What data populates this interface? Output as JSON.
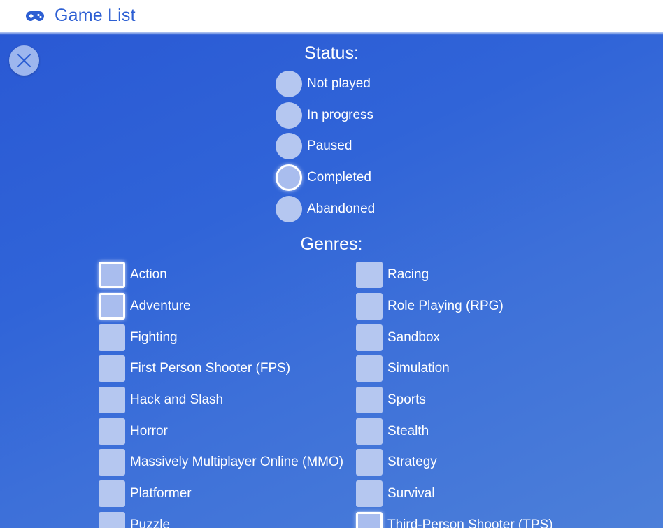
{
  "header": {
    "title": "Game List",
    "icon": "gamepad-icon",
    "title_color": "#2d5fd3"
  },
  "close_icon": "close-icon",
  "status": {
    "title": "Status:",
    "options": [
      {
        "label": "Not played",
        "selected": false
      },
      {
        "label": "In progress",
        "selected": false
      },
      {
        "label": "Paused",
        "selected": false
      },
      {
        "label": "Completed",
        "selected": true
      },
      {
        "label": "Abandoned",
        "selected": false
      }
    ]
  },
  "genres": {
    "title": "Genres:",
    "left": [
      {
        "label": "Action",
        "checked": true
      },
      {
        "label": "Adventure",
        "checked": true
      },
      {
        "label": "Fighting",
        "checked": false
      },
      {
        "label": "First Person Shooter (FPS)",
        "checked": false
      },
      {
        "label": "Hack and Slash",
        "checked": false
      },
      {
        "label": "Horror",
        "checked": false
      },
      {
        "label": "Massively Multiplayer Online (MMO)",
        "checked": false
      },
      {
        "label": "Platformer",
        "checked": false
      },
      {
        "label": "Puzzle",
        "checked": false
      }
    ],
    "right": [
      {
        "label": "Racing",
        "checked": false
      },
      {
        "label": "Role Playing (RPG)",
        "checked": false
      },
      {
        "label": "Sandbox",
        "checked": false
      },
      {
        "label": "Simulation",
        "checked": false
      },
      {
        "label": "Sports",
        "checked": false
      },
      {
        "label": "Stealth",
        "checked": false
      },
      {
        "label": "Strategy",
        "checked": false
      },
      {
        "label": "Survival",
        "checked": false
      },
      {
        "label": "Third-Person Shooter (TPS)",
        "checked": true
      }
    ]
  },
  "colors": {
    "panel_background": "#3064d8",
    "control_fill": "#b5c7f0",
    "selected_border": "#ffffff"
  }
}
